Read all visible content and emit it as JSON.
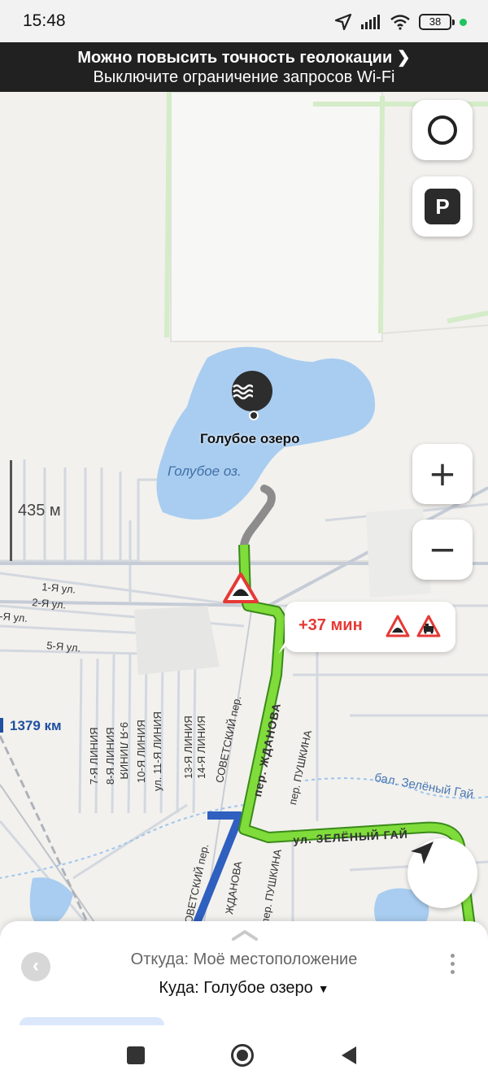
{
  "status_bar": {
    "time": "15:48",
    "battery": "38",
    "icons": [
      "location-arrow-icon",
      "signal-icon",
      "wifi-icon",
      "battery-icon",
      "green-dot-icon"
    ]
  },
  "banner": {
    "title": "Можно повысить точность геолокации",
    "subtitle": "Выключите ограничение запросов Wi-Fi"
  },
  "map": {
    "scale_label": "435 м",
    "poi_label": "Голубое озеро",
    "lake_label": "Голубое оз.",
    "distance_label": "1379 км",
    "route_callout": {
      "time": "+37 мин"
    },
    "buttons": {
      "zoom_in": "+",
      "zoom_out": "−",
      "parking": "P"
    },
    "streets": {
      "line1": "1-Я ул.",
      "line2": "2-Я ул.",
      "line3": "-Я ул.",
      "line5": "5-Я ул.",
      "liniya7": "7-Я ЛИНИЯ",
      "liniya8": "8-Я ЛИНИЯ",
      "liniya9": "9-Я ЛИНИЯ",
      "liniya10": "10-Я ЛИНИЯ",
      "liniya11": "ул. 11-Я ЛИНИЯ",
      "liniya13": "13-Я ЛИНИЯ",
      "liniya14": "14-Я ЛИНИЯ",
      "sovetsky": "СОВЕТСКИЙ пер.",
      "sovetsky2": "СОВЕТСКИЙ пер.",
      "zhdanova": "пер. ЖДАНОВА",
      "zhdanova2": "ЖДАНОВА",
      "pushkina": "пер. ПУШКИНА",
      "pushkina2": "пер. ПУШКИНА",
      "zeleny": "ул. ЗЕЛЁНЫЙ ГАЙ",
      "balka": "бал. Зелёный Гай"
    },
    "colors": {
      "water": "#a9cdf0",
      "route_main": "#7fdc3a",
      "route_walk": "#8c8c8c",
      "route_alt": "#2f5fbf",
      "accent_red": "#e53935"
    }
  },
  "sheet": {
    "from": "Откуда: Моё местоположение",
    "to": "Куда: Голубое озеро"
  }
}
